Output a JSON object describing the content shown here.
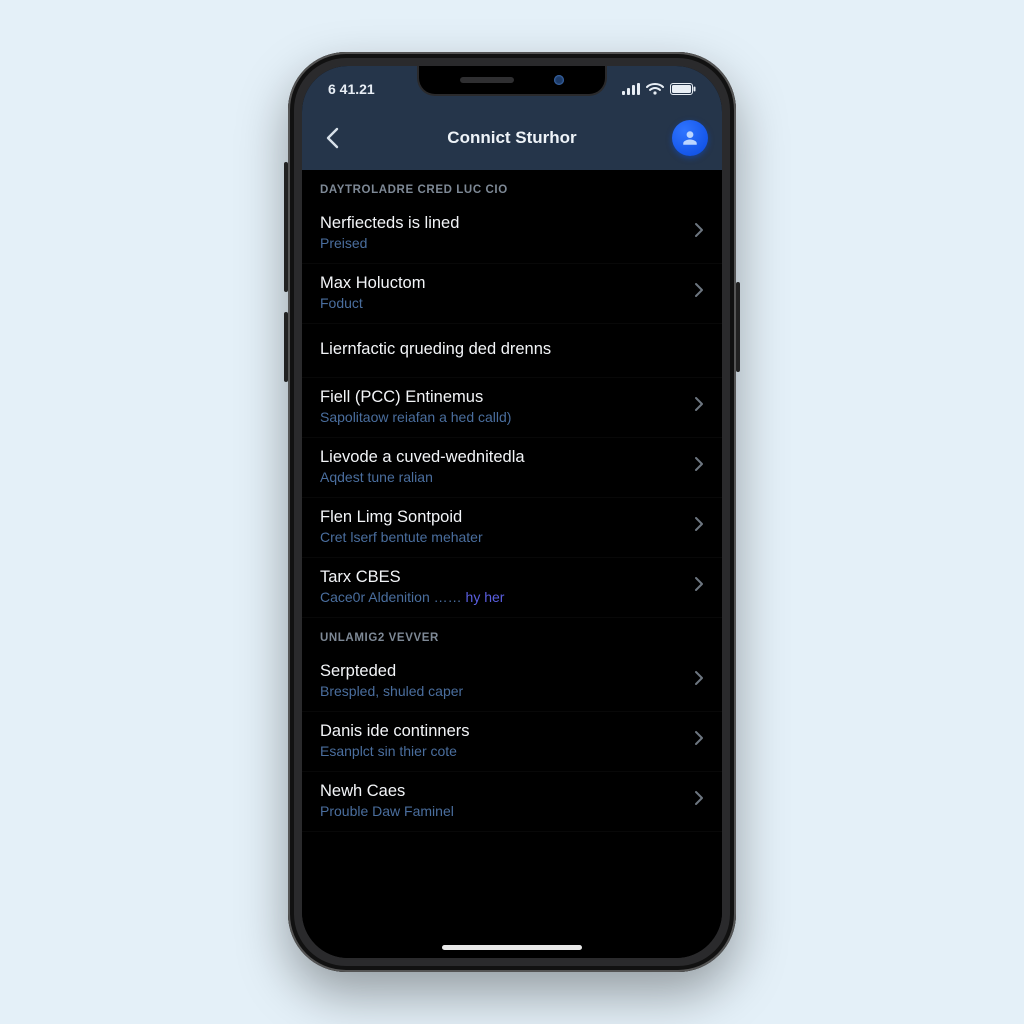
{
  "status": {
    "time": "6 41.21"
  },
  "nav": {
    "title": "Connict Sturhor"
  },
  "sections": [
    {
      "header": "DAYTROLADRE CRED LUC CIO",
      "rows": [
        {
          "title": "Nerfiecteds is lined",
          "sub": "Preised",
          "chevron": true
        },
        {
          "title": "Max Holuctom",
          "sub": "Foduct",
          "chevron": true
        },
        {
          "title": "Liernfactic qrueding ded drenns",
          "sub": "",
          "chevron": false
        },
        {
          "title": "Fiell (PCC) Entinemus",
          "sub": "Sapolitaow reiafan a hed calld)",
          "chevron": true
        },
        {
          "title": "Lievode a cuved-wednitedla",
          "sub": "Aqdest tune ralian",
          "chevron": true
        },
        {
          "title": "Flen Limg Sontpoid",
          "sub": "Cret lserf bentute mehater",
          "chevron": true
        },
        {
          "title": "Tarx CBES",
          "sub": "Cace0r Aldenition …… ",
          "sub_hl": "hy her",
          "chevron": true
        }
      ]
    },
    {
      "header": "UNLAMIG2 VEVVER",
      "rows": [
        {
          "title": "Serpteded",
          "sub": "Brespled, shuled caper",
          "chevron": true
        },
        {
          "title": "Danis ide continners",
          "sub": "Esanplct sin thier cote",
          "chevron": true
        },
        {
          "title": "Newh Caes",
          "sub": "Prouble Daw Faminel",
          "chevron": true
        }
      ]
    }
  ]
}
